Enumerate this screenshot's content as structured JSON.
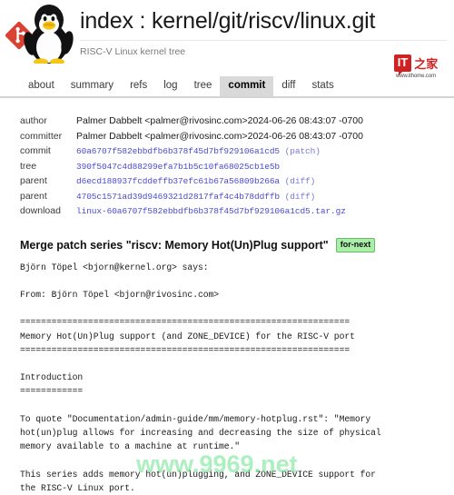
{
  "header": {
    "title": "index : kernel/git/riscv/linux.git",
    "subtitle": "RISC-V Linux kernel tree",
    "git_logo_icon": "git-logo-icon",
    "tux_logo_icon": "tux-penguin-icon",
    "ithome": {
      "badge_text": "IT",
      "cn_text": "之家",
      "url": "www.ithome.com",
      "brand_color": "#cf2323"
    }
  },
  "nav": {
    "items": [
      {
        "label": "about",
        "active": false
      },
      {
        "label": "summary",
        "active": false
      },
      {
        "label": "refs",
        "active": false
      },
      {
        "label": "log",
        "active": false
      },
      {
        "label": "tree",
        "active": false
      },
      {
        "label": "commit",
        "active": true
      },
      {
        "label": "diff",
        "active": false
      },
      {
        "label": "stats",
        "active": false
      }
    ],
    "active_tab": "commit"
  },
  "commit_info": {
    "rows": [
      {
        "label": "author",
        "name": "Palmer Dabbelt <palmer@rivosinc.com>",
        "date": "2024-06-26 08:43:07 -0700"
      },
      {
        "label": "committer",
        "name": "Palmer Dabbelt <palmer@rivosinc.com>",
        "date": "2024-06-26 08:43:07 -0700"
      }
    ],
    "commit": {
      "label": "commit",
      "hash": "60a6707f582ebbdfb6b378f45d7bf929106a1cd5",
      "link": "(patch)"
    },
    "tree": {
      "label": "tree",
      "hash": "390f5047c4d88299efa7b1b5c10fa68025cb1e5b"
    },
    "parents": [
      {
        "label": "parent",
        "hash": "d6ecd188937fcddeffb37efc61b67a56809b266a",
        "link": "(diff)"
      },
      {
        "label": "parent",
        "hash": "4705c1571ad39d9469321d2817faf4c4b78ddffb",
        "link": "(diff)"
      }
    ],
    "download": {
      "label": "download",
      "filename": "linux-60a6707f582ebbdfb6b378f45d7bf929106a1cd5.tar.gz"
    }
  },
  "commit_message": {
    "subject": "Merge patch series \"riscv: Memory Hot(Un)Plug support\"",
    "branch_badge": "for-next",
    "body": "Björn Töpel <bjorn@kernel.org> says:\n\nFrom: Björn Töpel <bjorn@rivosinc.com>\n\n===============================================================\nMemory Hot(Un)Plug support (and ZONE_DEVICE) for the RISC-V port\n===============================================================\n\nIntroduction\n============\n\nTo quote \"Documentation/admin-guide/mm/memory-hotplug.rst\": \"Memory\nhot(un)plug allows for increasing and decreasing the size of physical\nmemory available to a machine at runtime.\"\n\nThis series adds memory hot(un)plugging, and ZONE_DEVICE support for\nthe RISC-V Linux port."
  },
  "watermark": {
    "text": "www.9969.net",
    "color": "#78e696"
  }
}
